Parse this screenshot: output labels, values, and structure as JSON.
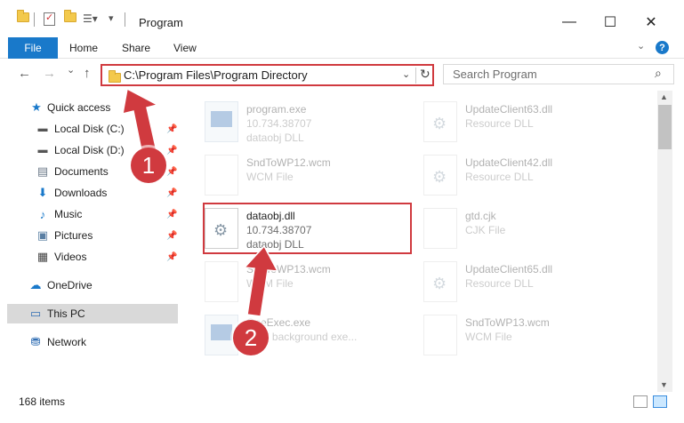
{
  "window": {
    "title": "Program",
    "minimize_glyph": "—",
    "maximize_glyph": "☐",
    "close_glyph": "✕"
  },
  "ribbon": {
    "tabs": [
      "File",
      "Home",
      "Share",
      "View"
    ],
    "help_glyph": "?"
  },
  "navigation": {
    "back_glyph": "←",
    "forward_glyph": "→",
    "recent_glyph": "⌄",
    "up_glyph": "↑",
    "address": "C:\\Program Files\\Program Directory",
    "refresh_glyph": "↻",
    "search_placeholder": "Search Program"
  },
  "sidebar": {
    "items": [
      {
        "label": "Quick access",
        "icon": "star-icon",
        "pinned": false
      },
      {
        "label": "Local Disk (C:)",
        "icon": "drive-icon",
        "pinned": true
      },
      {
        "label": "Local Disk (D:)",
        "icon": "drive-icon",
        "pinned": true
      },
      {
        "label": "Documents",
        "icon": "documents-icon",
        "pinned": true
      },
      {
        "label": "Downloads",
        "icon": "download-icon",
        "pinned": true
      },
      {
        "label": "Music",
        "icon": "music-icon",
        "pinned": true
      },
      {
        "label": "Pictures",
        "icon": "pictures-icon",
        "pinned": true
      },
      {
        "label": "Videos",
        "icon": "videos-icon",
        "pinned": true
      },
      {
        "label": "OneDrive",
        "icon": "cloud-icon",
        "pinned": false
      },
      {
        "label": "This PC",
        "icon": "computer-icon",
        "pinned": false,
        "selected": true
      },
      {
        "label": "Network",
        "icon": "network-icon",
        "pinned": false
      }
    ]
  },
  "files": [
    {
      "name": "program.exe",
      "line1": "10.734.38707",
      "line2": "dataobj DLL",
      "type": "exe",
      "faded": true
    },
    {
      "name": "UpdateClient63.dll",
      "line1": "Resource DLL",
      "line2": "",
      "type": "gear",
      "faded": true
    },
    {
      "name": "SndToWP12.wcm",
      "line1": "WCM File",
      "line2": "",
      "type": "doc",
      "faded": true
    },
    {
      "name": "UpdateClient42.dll",
      "line1": "Resource DLL",
      "line2": "",
      "type": "gear",
      "faded": true
    },
    {
      "name": "dataobj.dll",
      "line1": "10.734.38707",
      "line2": "dataobj DLL",
      "type": "gear",
      "faded": false
    },
    {
      "name": "gtd.cjk",
      "line1": "CJK File",
      "line2": "",
      "type": "doc",
      "faded": true
    },
    {
      "name": "SndToWP13.wcm",
      "line1": "WCM File",
      "line2": "",
      "type": "doc",
      "faded": true
    },
    {
      "name": "UpdateClient65.dll",
      "line1": "Resource DLL",
      "line2": "",
      "type": "gear",
      "faded": true
    },
    {
      "name": "OneExec.exe",
      "line1": "ORY background exe...",
      "line2": "",
      "type": "exe",
      "faded": true
    },
    {
      "name": "SndToWP13.wcm",
      "line1": "WCM File",
      "line2": "",
      "type": "doc",
      "faded": true
    }
  ],
  "status": {
    "item_count": "168 items"
  },
  "annotations": {
    "marker1": "1",
    "marker2": "2",
    "color": "#d03a3f"
  }
}
